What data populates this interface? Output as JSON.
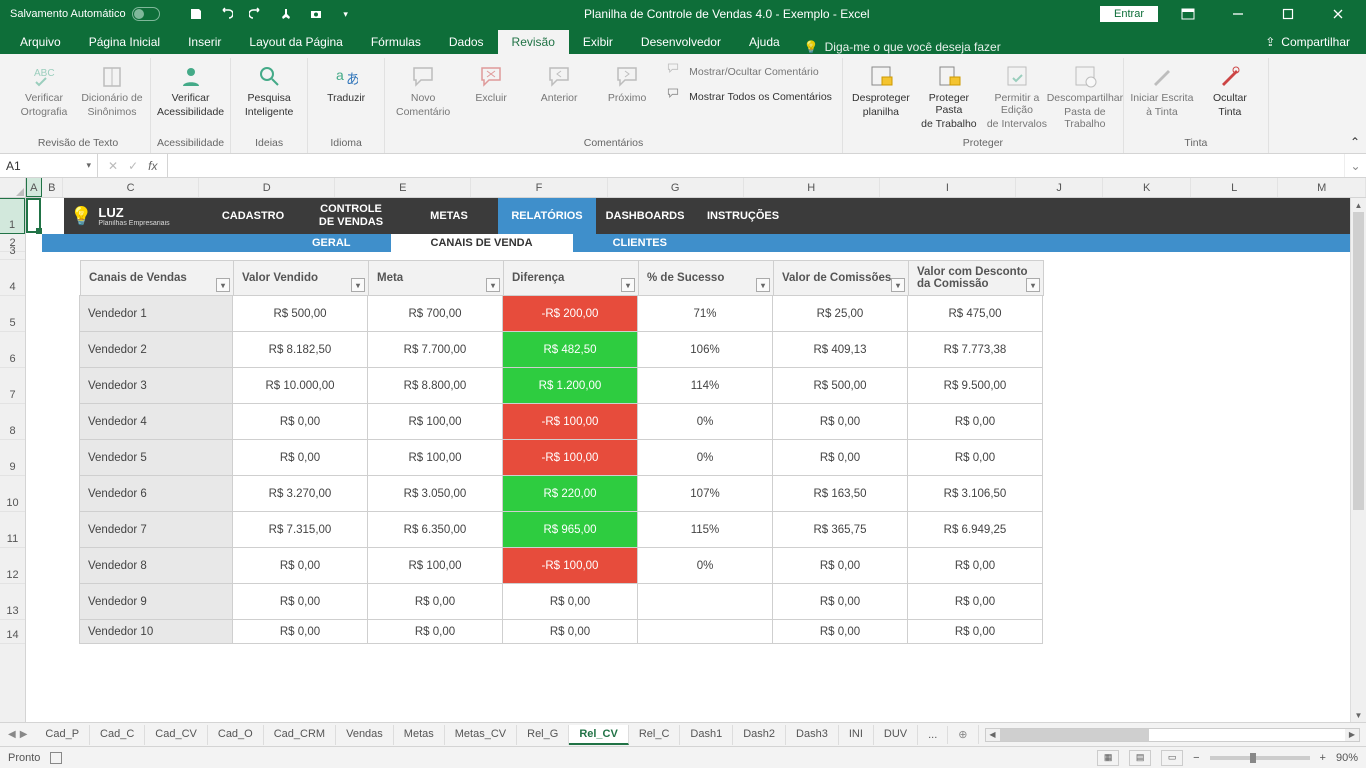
{
  "titlebar": {
    "autosave_label": "Salvamento Automático",
    "title": "Planilha de Controle de Vendas 4.0 - Exemplo  -  Excel",
    "signin": "Entrar"
  },
  "tabs": {
    "items": [
      "Arquivo",
      "Página Inicial",
      "Inserir",
      "Layout da Página",
      "Fórmulas",
      "Dados",
      "Revisão",
      "Exibir",
      "Desenvolvedor",
      "Ajuda"
    ],
    "active": 6,
    "tellme": "Diga-me o que você deseja fazer",
    "share": "Compartilhar"
  },
  "ribbon": {
    "groups": [
      {
        "label": "Revisão de Texto",
        "items": [
          {
            "l1": "Verificar",
            "l2": "Ortografia",
            "icon": "abc"
          },
          {
            "l1": "Dicionário de",
            "l2": "Sinônimos",
            "icon": "book"
          }
        ]
      },
      {
        "label": "Acessibilidade",
        "items": [
          {
            "l1": "Verificar",
            "l2": "Acessibilidade",
            "icon": "person",
            "enabled": true
          }
        ]
      },
      {
        "label": "Ideias",
        "items": [
          {
            "l1": "Pesquisa",
            "l2": "Inteligente",
            "icon": "search",
            "enabled": true
          }
        ]
      },
      {
        "label": "Idioma",
        "items": [
          {
            "l1": "Traduzir",
            "l2": "",
            "icon": "translate",
            "enabled": true
          }
        ]
      },
      {
        "label": "Comentários",
        "items": [
          {
            "l1": "Novo",
            "l2": "Comentário",
            "icon": "comment"
          },
          {
            "l1": "Excluir",
            "l2": "",
            "icon": "delete"
          },
          {
            "l1": "Anterior",
            "l2": "",
            "icon": "prev"
          },
          {
            "l1": "Próximo",
            "l2": "",
            "icon": "next"
          }
        ],
        "side": [
          {
            "label": "Mostrar/Ocultar Comentário",
            "icon": "comment-s"
          },
          {
            "label": "Mostrar Todos os Comentários",
            "icon": "comment-s",
            "enabled": true
          }
        ]
      },
      {
        "label": "Proteger",
        "items": [
          {
            "l1": "Desproteger",
            "l2": "planilha",
            "icon": "sheet-lock",
            "enabled": true
          },
          {
            "l1": "Proteger Pasta",
            "l2": "de Trabalho",
            "icon": "book-lock",
            "enabled": true
          },
          {
            "l1": "Permitir a Edição",
            "l2": "de Intervalos",
            "icon": "ranges"
          },
          {
            "l1": "Descompartilhar",
            "l2": "Pasta de Trabalho",
            "icon": "unshare"
          }
        ]
      },
      {
        "label": "Tinta",
        "items": [
          {
            "l1": "Iniciar Escrita",
            "l2": "à Tinta",
            "icon": "pen"
          },
          {
            "l1": "Ocultar",
            "l2": "Tinta",
            "icon": "hideink",
            "enabled": true
          }
        ]
      }
    ]
  },
  "formula": {
    "namebox": "A1",
    "value": ""
  },
  "columns": [
    "A",
    "B",
    "C",
    "D",
    "E",
    "F",
    "G",
    "H",
    "I",
    "J",
    "K",
    "L",
    "M"
  ],
  "rows_visible": [
    "1",
    "2",
    "3",
    "4",
    "5",
    "6",
    "7",
    "8",
    "9",
    "10",
    "11",
    "12",
    "13",
    "14"
  ],
  "nav": {
    "logo_main": "LUZ",
    "logo_sub": "Planilhas Empresariais",
    "items": [
      "CADASTRO",
      "CONTROLE DE VENDAS",
      "METAS",
      "RELATÓRIOS",
      "DASHBOARDS",
      "INSTRUÇÕES"
    ],
    "active": 3
  },
  "subnav": {
    "items": [
      "GERAL",
      "CANAIS DE VENDA",
      "CLIENTES"
    ],
    "active": 1
  },
  "table": {
    "headers": [
      "Canais de Vendas",
      "Valor Vendido",
      "Meta",
      "Diferença",
      "% de Sucesso",
      "Valor de Comissões",
      "Valor com Desconto da Comissão"
    ],
    "rows": [
      {
        "name": "Vendedor 1",
        "vv": "R$ 500,00",
        "meta": "R$ 700,00",
        "diff": "-R$ 200,00",
        "ds": "neg",
        "pct": "71%",
        "com": "R$ 25,00",
        "desc": "R$ 475,00"
      },
      {
        "name": "Vendedor 2",
        "vv": "R$ 8.182,50",
        "meta": "R$ 7.700,00",
        "diff": "R$ 482,50",
        "ds": "pos",
        "pct": "106%",
        "com": "R$ 409,13",
        "desc": "R$ 7.773,38"
      },
      {
        "name": "Vendedor 3",
        "vv": "R$ 10.000,00",
        "meta": "R$ 8.800,00",
        "diff": "R$ 1.200,00",
        "ds": "pos",
        "pct": "114%",
        "com": "R$ 500,00",
        "desc": "R$ 9.500,00"
      },
      {
        "name": "Vendedor 4",
        "vv": "R$ 0,00",
        "meta": "R$ 100,00",
        "diff": "-R$ 100,00",
        "ds": "neg",
        "pct": "0%",
        "com": "R$ 0,00",
        "desc": "R$ 0,00"
      },
      {
        "name": "Vendedor 5",
        "vv": "R$ 0,00",
        "meta": "R$ 100,00",
        "diff": "-R$ 100,00",
        "ds": "neg",
        "pct": "0%",
        "com": "R$ 0,00",
        "desc": "R$ 0,00"
      },
      {
        "name": "Vendedor 6",
        "vv": "R$ 3.270,00",
        "meta": "R$ 3.050,00",
        "diff": "R$ 220,00",
        "ds": "pos",
        "pct": "107%",
        "com": "R$ 163,50",
        "desc": "R$ 3.106,50"
      },
      {
        "name": "Vendedor 7",
        "vv": "R$ 7.315,00",
        "meta": "R$ 6.350,00",
        "diff": "R$ 965,00",
        "ds": "pos",
        "pct": "115%",
        "com": "R$ 365,75",
        "desc": "R$ 6.949,25"
      },
      {
        "name": "Vendedor 8",
        "vv": "R$ 0,00",
        "meta": "R$ 100,00",
        "diff": "-R$ 100,00",
        "ds": "neg",
        "pct": "0%",
        "com": "R$ 0,00",
        "desc": "R$ 0,00"
      },
      {
        "name": "Vendedor 9",
        "vv": "R$ 0,00",
        "meta": "R$ 0,00",
        "diff": "R$ 0,00",
        "ds": "",
        "pct": "",
        "com": "R$ 0,00",
        "desc": "R$ 0,00"
      },
      {
        "name": "Vendedor 10",
        "vv": "R$ 0,00",
        "meta": "R$ 0,00",
        "diff": "R$ 0,00",
        "ds": "",
        "pct": "",
        "com": "R$ 0,00",
        "desc": "R$ 0,00"
      }
    ]
  },
  "sheets": {
    "items": [
      "Cad_P",
      "Cad_C",
      "Cad_CV",
      "Cad_O",
      "Cad_CRM",
      "Vendas",
      "Metas",
      "Metas_CV",
      "Rel_G",
      "Rel_CV",
      "Rel_C",
      "Dash1",
      "Dash2",
      "Dash3",
      "INI",
      "DUV"
    ],
    "more": "...",
    "active": 9
  },
  "status": {
    "ready": "Pronto",
    "zoom": "90%"
  }
}
